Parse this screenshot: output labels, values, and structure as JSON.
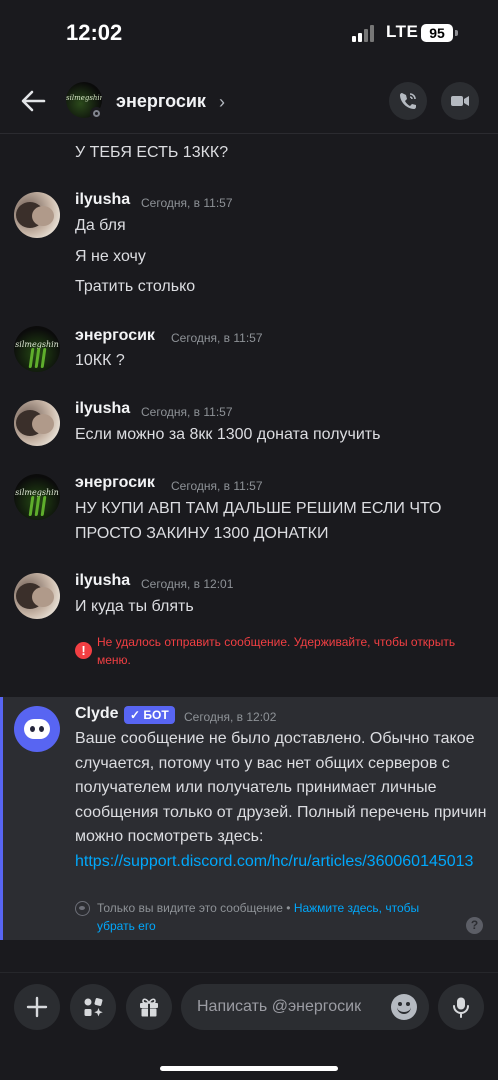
{
  "status_bar": {
    "time": "12:02",
    "network": "LTE",
    "battery": "95"
  },
  "header": {
    "name": "энергосик",
    "chevron": "›",
    "avatar_text": "silmegshin"
  },
  "partial_message": "У ТЕБЯ ЕСТЬ 13КК?",
  "messages": [
    {
      "author": "ilyusha",
      "time": "Сегодня, в 11:57",
      "lines": [
        "Да бля",
        "Я не хочу",
        "Тратить столько"
      ]
    },
    {
      "author": "энергосик",
      "time": "Сегодня, в 11:57",
      "lines": [
        "10КК ?"
      ]
    },
    {
      "author": "ilyusha",
      "time": "Сегодня, в 11:57",
      "lines": [
        "Если можно за 8кк 1300 доната получить"
      ]
    },
    {
      "author": "энергосик",
      "time": "Сегодня, в 11:57",
      "lines": [
        "НУ КУПИ АВП ТАМ ДАЛЬШЕ РЕШИМ ЕСЛИ ЧТО ПРОСТО ЗАКИНУ 1300 ДОНАТКИ"
      ]
    },
    {
      "author": "ilyusha",
      "time": "Сегодня, в 12:01",
      "lines": [
        "И куда ты блять"
      ]
    }
  ],
  "send_error": {
    "icon": "!",
    "text": "Не удалось отправить сообщение. Удерживайте, чтобы открыть меню."
  },
  "clyde": {
    "author": "Clyde",
    "badge": "✓ БОТ",
    "time": "Сегодня, в 12:02",
    "text": "Ваше сообщение не было доставлено. Обычно такое случается, потому что у вас нет общих серверов с получателем или получатель принимает личные сообщения только от друзей. Полный перечень причин можно посмотреть здесь: ",
    "link": "https://support.discord.com/hc/ru/articles/360060145013",
    "ephemeral_note": "Только вы видите это сообщение • ",
    "ephemeral_link": "Нажмите здесь, чтобы убрать его",
    "help": "?"
  },
  "composer": {
    "placeholder": "Написать @энергосик"
  },
  "colors": {
    "accent": "#5865f2",
    "error": "#f23f43",
    "link": "#00a8fc",
    "background": "#1a1a1e"
  }
}
